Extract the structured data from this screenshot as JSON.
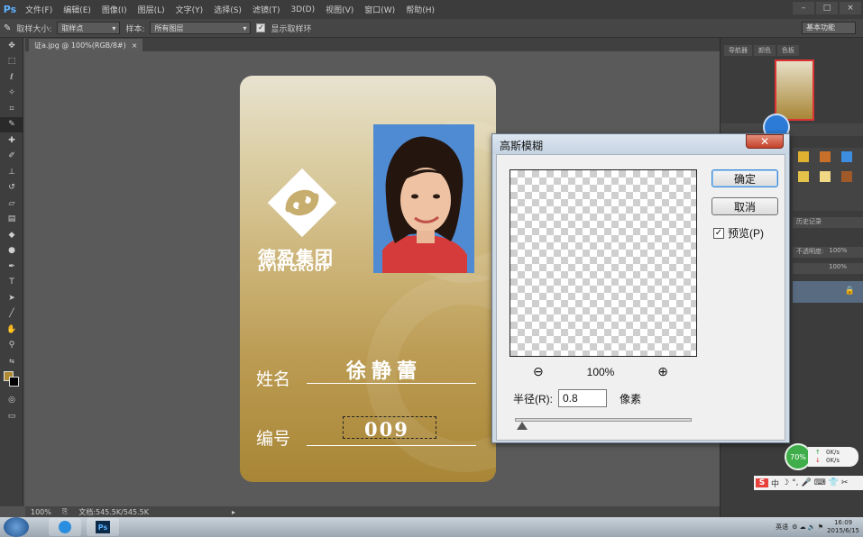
{
  "app": {
    "logo": "Ps"
  },
  "menu": [
    "文件(F)",
    "编辑(E)",
    "图像(I)",
    "图层(L)",
    "文字(Y)",
    "选择(S)",
    "滤镜(T)",
    "3D(D)",
    "视图(V)",
    "窗口(W)",
    "帮助(H)"
  ],
  "options": {
    "sample_size_label": "取样大小:",
    "sample_size_value": "取样点",
    "sample_label": "样本:",
    "sample_value": "所有图层",
    "show_ring_label": "显示取样环",
    "workspace": "基本功能"
  },
  "document": {
    "tab_title": "证a.jpg @ 100%(RGB/8#)",
    "close": "×"
  },
  "card": {
    "brand_cn": "德盈集团",
    "brand_en": "DYIN GROUP",
    "name_label": "姓名",
    "name_value": "徐静蕾",
    "number_label": "编号",
    "number_value": "009"
  },
  "status": {
    "zoom": "100%",
    "doc_info": "文档:545.5K/545.5K"
  },
  "panels": {
    "tabs": [
      "导航器",
      "颜色",
      "色板"
    ],
    "history_header": "历史记录",
    "blend_mode": "不透明度:",
    "opacity": "100%",
    "fill": "100%"
  },
  "speed_widget": {
    "percent": "70%",
    "up": "0K/s",
    "down": "0K/s"
  },
  "ime": {
    "label": "中"
  },
  "tray": {
    "lang": "英语",
    "time": "16:09",
    "date": "2015/6/15"
  },
  "dialog": {
    "title": "高斯模糊",
    "ok": "确定",
    "cancel": "取消",
    "preview_label": "预览(P)",
    "preview_checked": "✓",
    "zoom": "100%",
    "radius_label": "半径(R):",
    "radius_value": "0.8",
    "radius_unit": "像素",
    "radius_slider_fraction": 0.04
  }
}
